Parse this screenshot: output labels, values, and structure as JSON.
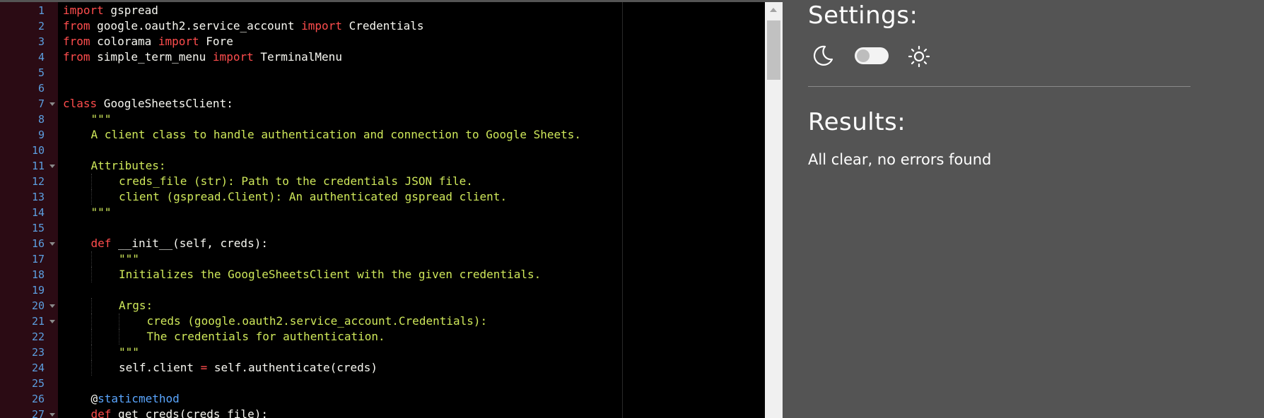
{
  "editor": {
    "lines": [
      {
        "n": "1",
        "fold": false,
        "indent": 0,
        "tokens": [
          [
            "kw",
            "import"
          ],
          [
            "t",
            " gspread"
          ]
        ]
      },
      {
        "n": "2",
        "fold": false,
        "indent": 0,
        "tokens": [
          [
            "kw",
            "from"
          ],
          [
            "t",
            " google.oauth2.service_account "
          ],
          [
            "kw",
            "import"
          ],
          [
            "t",
            " Credentials"
          ]
        ]
      },
      {
        "n": "3",
        "fold": false,
        "indent": 0,
        "tokens": [
          [
            "kw",
            "from"
          ],
          [
            "t",
            " colorama "
          ],
          [
            "kw",
            "import"
          ],
          [
            "t",
            " Fore"
          ]
        ]
      },
      {
        "n": "4",
        "fold": false,
        "indent": 0,
        "tokens": [
          [
            "kw",
            "from"
          ],
          [
            "t",
            " simple_term_menu "
          ],
          [
            "kw",
            "import"
          ],
          [
            "t",
            " TerminalMenu"
          ]
        ]
      },
      {
        "n": "5",
        "fold": false,
        "indent": 0,
        "tokens": []
      },
      {
        "n": "6",
        "fold": false,
        "indent": 0,
        "tokens": []
      },
      {
        "n": "7",
        "fold": true,
        "indent": 0,
        "tokens": [
          [
            "kw",
            "class"
          ],
          [
            "t",
            " GoogleSheetsClient:"
          ]
        ]
      },
      {
        "n": "8",
        "fold": false,
        "indent": 1,
        "tokens": [
          [
            "str",
            "\"\"\""
          ]
        ]
      },
      {
        "n": "9",
        "fold": false,
        "indent": 1,
        "tokens": [
          [
            "str",
            "A client class to handle authentication and connection to Google Sheets."
          ]
        ]
      },
      {
        "n": "10",
        "fold": false,
        "indent": 0,
        "tokens": []
      },
      {
        "n": "11",
        "fold": true,
        "indent": 1,
        "tokens": [
          [
            "str",
            "Attributes:"
          ]
        ]
      },
      {
        "n": "12",
        "fold": false,
        "indent": 2,
        "tokens": [
          [
            "str",
            "creds_file (str): Path to the credentials JSON file."
          ]
        ]
      },
      {
        "n": "13",
        "fold": false,
        "indent": 2,
        "tokens": [
          [
            "str",
            "client (gspread.Client): An authenticated gspread client."
          ]
        ]
      },
      {
        "n": "14",
        "fold": false,
        "indent": 1,
        "tokens": [
          [
            "str",
            "\"\"\""
          ]
        ]
      },
      {
        "n": "15",
        "fold": false,
        "indent": 0,
        "tokens": []
      },
      {
        "n": "16",
        "fold": true,
        "indent": 1,
        "tokens": [
          [
            "kw",
            "def"
          ],
          [
            "t",
            " __init__(self, creds):"
          ]
        ]
      },
      {
        "n": "17",
        "fold": false,
        "indent": 2,
        "tokens": [
          [
            "str",
            "\"\"\""
          ]
        ]
      },
      {
        "n": "18",
        "fold": false,
        "indent": 2,
        "tokens": [
          [
            "str",
            "Initializes the GoogleSheetsClient with the given credentials."
          ]
        ]
      },
      {
        "n": "19",
        "fold": false,
        "indent": 0,
        "tokens": []
      },
      {
        "n": "20",
        "fold": true,
        "indent": 2,
        "tokens": [
          [
            "str",
            "Args:"
          ]
        ]
      },
      {
        "n": "21",
        "fold": true,
        "indent": 3,
        "tokens": [
          [
            "str",
            "creds (google.oauth2.service_account.Credentials):"
          ]
        ]
      },
      {
        "n": "22",
        "fold": false,
        "indent": 3,
        "tokens": [
          [
            "str",
            "The credentials for authentication."
          ]
        ]
      },
      {
        "n": "23",
        "fold": false,
        "indent": 2,
        "tokens": [
          [
            "str",
            "\"\"\""
          ]
        ]
      },
      {
        "n": "24",
        "fold": false,
        "indent": 2,
        "tokens": [
          [
            "t",
            "self.client "
          ],
          [
            "op",
            "="
          ],
          [
            "t",
            " self.authenticate(creds)"
          ]
        ]
      },
      {
        "n": "25",
        "fold": false,
        "indent": 0,
        "tokens": []
      },
      {
        "n": "26",
        "fold": false,
        "indent": 1,
        "tokens": [
          [
            "deco",
            "@"
          ],
          [
            "builtin",
            "staticmethod"
          ]
        ]
      },
      {
        "n": "27",
        "fold": true,
        "indent": 1,
        "tokens": [
          [
            "kw",
            "def"
          ],
          [
            "t",
            " get_creds(creds_file):"
          ]
        ]
      }
    ]
  },
  "settings": {
    "title": "Settings:",
    "moon_icon": "moon-icon",
    "sun_icon": "sun-icon",
    "toggle_state": "off"
  },
  "results": {
    "title": "Results:",
    "message": "All clear, no errors found"
  },
  "colors": {
    "editor_bg": "#000000",
    "gutter_bg": "#2b0b14",
    "line_number": "#5c9fe0",
    "keyword": "#ff4d4d",
    "string": "#cfe85a",
    "builtin": "#5aa6ff",
    "panel_bg": "#545454"
  }
}
